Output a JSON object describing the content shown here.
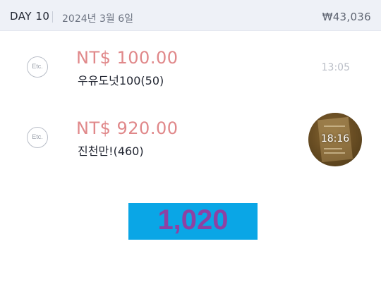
{
  "header": {
    "day_label": "DAY 10",
    "date": "2024년 3월 6일",
    "total": "₩43,036"
  },
  "entries": [
    {
      "category_icon": "etc-icon",
      "category_label": "Etc.",
      "amount": "NT$ 100.00",
      "description": "우유도넛100(50)",
      "time": "13:05"
    },
    {
      "category_icon": "etc-icon",
      "category_label": "Etc.",
      "amount": "NT$ 920.00",
      "description": "진천만!(460)",
      "time": "18:16",
      "has_photo": true
    }
  ],
  "summary": {
    "value": "1,020"
  },
  "colors": {
    "amount": "#e0888a",
    "header_bg": "#eef1f7",
    "summary_bg": "#0aa6e6",
    "summary_text": "#8e41a3"
  }
}
